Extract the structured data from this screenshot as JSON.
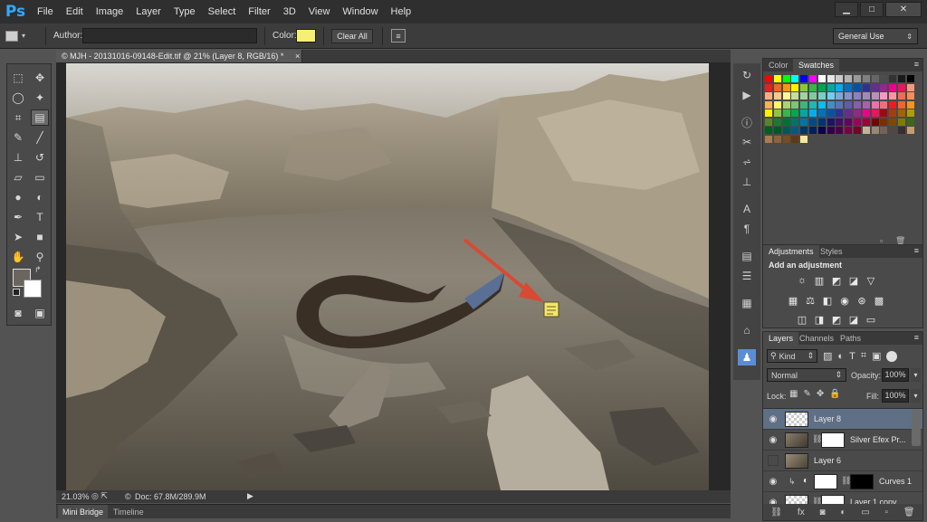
{
  "app": {
    "logo": "Ps"
  },
  "menu": [
    "File",
    "Edit",
    "Image",
    "Layer",
    "Type",
    "Select",
    "Filter",
    "3D",
    "View",
    "Window",
    "Help"
  ],
  "window_controls": {
    "minimize": "▁",
    "maximize": "□",
    "close": "✕"
  },
  "options": {
    "author_label": "Author:",
    "author_value": "",
    "color_label": "Color:",
    "note_color": "#f5ef73",
    "clear_all": "Clear All",
    "workspace": "General Use"
  },
  "document": {
    "tab_title": "© MJH - 20131016-09148-Edit.tif @ 21% (Layer 8, RGB/16) *",
    "tab_close": "×",
    "zoom": "21.03%",
    "doc_size": "Doc: 67.8M/289.9M"
  },
  "bottom_tabs": [
    "Mini Bridge",
    "Timeline"
  ],
  "panels": {
    "color_tabs": [
      "Color",
      "Swatches"
    ],
    "active_color_tab": "Swatches",
    "adjustments_tabs": [
      "Adjustments",
      "Styles"
    ],
    "adjustments_heading": "Add an adjustment",
    "layers_tabs": [
      "Layers",
      "Channels",
      "Paths"
    ],
    "kind_label": "Kind",
    "blend_mode": "Normal",
    "opacity_label": "Opacity:",
    "opacity_value": "100%",
    "lock_label": "Lock:",
    "fill_label": "Fill:",
    "fill_value": "100%"
  },
  "layers": [
    {
      "name": "Layer 8",
      "visible": true,
      "selected": true
    },
    {
      "name": "Silver Efex Pr...",
      "visible": true,
      "selected": false
    },
    {
      "name": "Layer 6",
      "visible": false,
      "selected": false
    },
    {
      "name": "Curves 1",
      "visible": true,
      "selected": false
    },
    {
      "name": "Layer 1 copy",
      "visible": true,
      "selected": false
    }
  ],
  "colors": {
    "accent": "#31a8ff",
    "selected_layer": "#5f6f86",
    "arrow": "#d74a34"
  }
}
